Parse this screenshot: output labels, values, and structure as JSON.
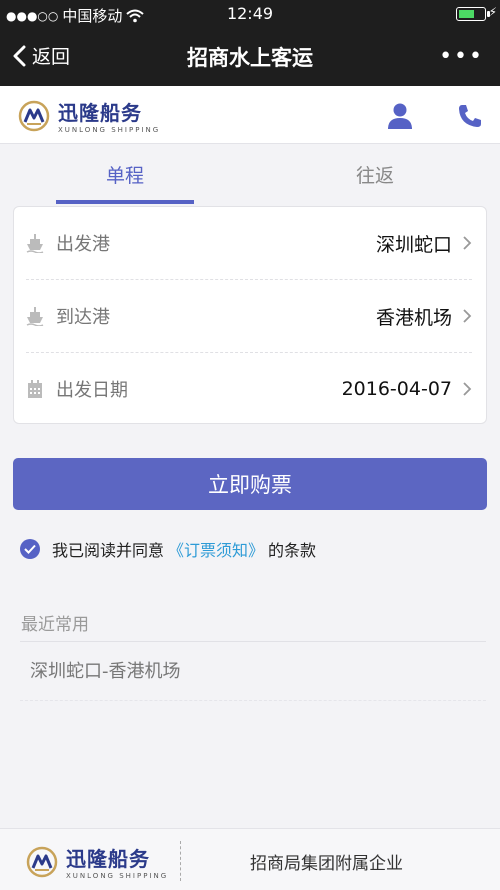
{
  "status_bar": {
    "signal": "●●●○○",
    "carrier": "中国移动",
    "time": "12:49"
  },
  "nav": {
    "back_label": "返回",
    "title": "招商水上客运",
    "more_label": "•••"
  },
  "brand": {
    "name_cn": "迅隆船务",
    "name_en": "XUNLONG SHIPPING"
  },
  "tabs": [
    {
      "label": "单程",
      "active": true
    },
    {
      "label": "往返",
      "active": false
    }
  ],
  "form": {
    "rows": [
      {
        "label": "出发港",
        "value": "深圳蛇口",
        "icon": "ship-icon"
      },
      {
        "label": "到达港",
        "value": "香港机场",
        "icon": "ship-icon"
      },
      {
        "label": "出发日期",
        "value": "2016-04-07",
        "icon": "calendar-icon"
      }
    ]
  },
  "buy_button": "立即购票",
  "agreement": {
    "prefix": "我已阅读并同意",
    "link": "《订票须知》",
    "suffix": "的条款",
    "checked": true
  },
  "recent": {
    "title": "最近常用",
    "items": [
      "深圳蛇口-香港机场"
    ]
  },
  "footer": {
    "brand_cn": "迅隆船务",
    "brand_en": "XUNLONG SHIPPING",
    "text": "招商局集团附属企业"
  },
  "colors": {
    "accent": "#5662c5",
    "button": "#5c66c2",
    "link": "#2e9bd6",
    "top_bar": "#1e1e1e",
    "battery": "#4cd964"
  }
}
